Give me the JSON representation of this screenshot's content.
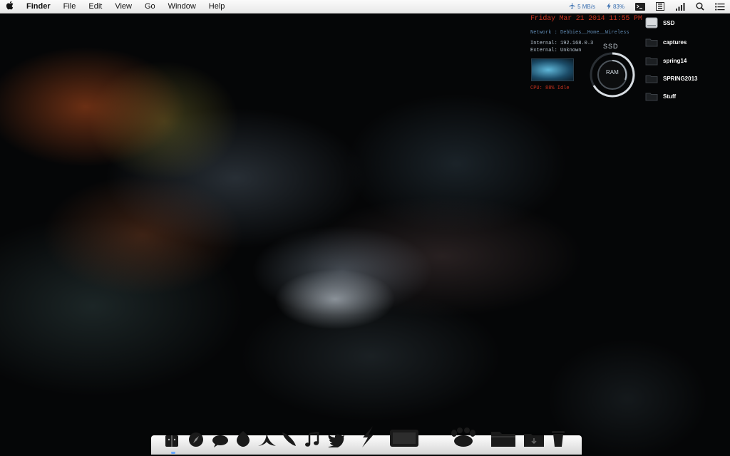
{
  "menubar": {
    "apple_icon": "apple-icon",
    "app_name": "Finder",
    "items": [
      "File",
      "Edit",
      "View",
      "Go",
      "Window",
      "Help"
    ],
    "network_speed": "5 MB/s",
    "battery": "83%"
  },
  "geektool": {
    "datetime": "Friday Mar 21 2014 11:55 PM",
    "network": "Network : Debbies__Home__Wireless",
    "internal": "Internal: 192.168.0.3",
    "external": "External: Unknown",
    "cpu": "CPU: 88% Idle"
  },
  "ring_meter": {
    "top_label": "SSD",
    "center_label": "RAM"
  },
  "desktop_icons": [
    {
      "label": "SSD",
      "icon": "drive-icon"
    },
    {
      "label": "captures",
      "icon": "folder-icon"
    },
    {
      "label": "spring14",
      "icon": "folder-icon"
    },
    {
      "label": "SPRING2013",
      "icon": "folder-icon"
    },
    {
      "label": "Stuff",
      "icon": "folder-icon"
    }
  ],
  "dock": {
    "items": [
      "finder-icon",
      "safari-icon",
      "messages-icon",
      "mail-icon",
      "launchpad-icon",
      "notes-icon",
      "music-icon",
      "twitter-icon",
      "lightning-icon",
      "display-icon",
      "paw-icon",
      "folder-icon",
      "downloads-folder-icon",
      "trash-icon"
    ]
  },
  "colors": {
    "geektool_red": "#c8321e",
    "geektool_blue": "#5f88b0",
    "menubar_status_blue": "#3a6fb0"
  }
}
